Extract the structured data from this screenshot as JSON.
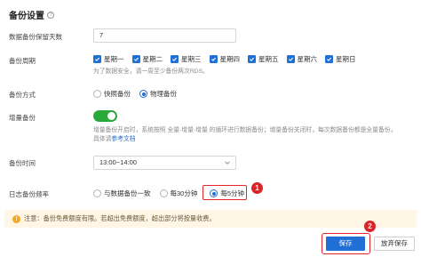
{
  "header": {
    "title": "备份设置"
  },
  "retention": {
    "label": "数据备份保留天数",
    "value": "7"
  },
  "cycle": {
    "label": "备份周期",
    "days": [
      "星期一",
      "星期二",
      "星期三",
      "星期四",
      "星期五",
      "星期六",
      "星期日"
    ],
    "hint": "为了数据安全，请一周至少备份两次RDS。"
  },
  "method": {
    "label": "备份方式",
    "options": [
      "快照备份",
      "物理备份"
    ],
    "selected": "物理备份"
  },
  "incremental": {
    "label": "增量备份",
    "enabled": true,
    "hint_line1": "增量备份开启时，系统按照 全量-增量-增量 的循环进行数据备份；增量备份关闭时，每次数据备份都是全量备份，",
    "hint_line2_prefix": "具体请",
    "hint_link": "参考文档"
  },
  "time": {
    "label": "备份时间",
    "value": "13:00~14:00"
  },
  "log_frequency": {
    "label": "日志备份频率",
    "options": [
      "与数据备份一致",
      "每30分钟",
      "每5分钟"
    ],
    "selected": "每5分钟"
  },
  "notice": {
    "text": "注意：备份免费额度有限。若超出免费额度，超出部分将按量收费。"
  },
  "actions": {
    "save": "保存",
    "cancel": "放弃保存"
  },
  "annotations": {
    "badge1": "1",
    "badge2": "2"
  },
  "colors": {
    "primary": "#1f6fd6",
    "toggle_on": "#2aa839",
    "highlight": "#e0262b",
    "notice_bg": "#fff6e6"
  }
}
